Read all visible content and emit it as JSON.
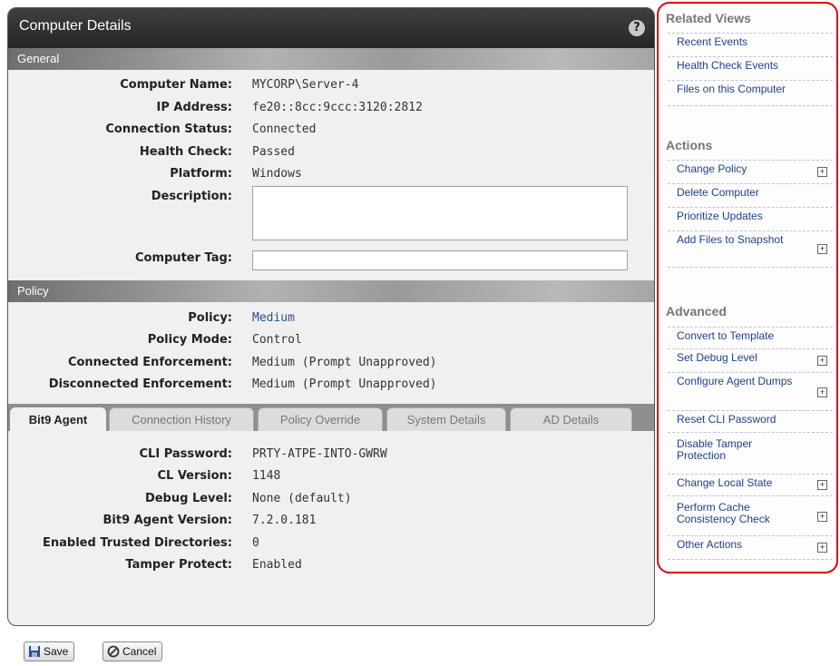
{
  "window": {
    "title": "Computer Details"
  },
  "general": {
    "section_label": "General",
    "fields": [
      {
        "label": "Computer Name:",
        "value": "MYCORP\\Server-4"
      },
      {
        "label": "IP Address:",
        "value": "fe20::8cc:9ccc:3120:2812"
      },
      {
        "label": "Connection Status:",
        "value": "Connected"
      },
      {
        "label": "Health Check:",
        "value": "Passed"
      },
      {
        "label": "Platform:",
        "value": "Windows"
      }
    ],
    "description_label": "Description:",
    "description_value": "",
    "tag_label": "Computer Tag:",
    "tag_value": ""
  },
  "policy": {
    "section_label": "Policy",
    "fields": [
      {
        "label": "Policy:",
        "value": "Medium"
      },
      {
        "label": "Policy Mode:",
        "value": "Control"
      },
      {
        "label": "Connected Enforcement:",
        "value": "Medium (Prompt Unapproved)"
      },
      {
        "label": "Disconnected Enforcement:",
        "value": "Medium (Prompt Unapproved)"
      }
    ]
  },
  "tabs": [
    {
      "label": "Bit9 Agent"
    },
    {
      "label": "Connection History"
    },
    {
      "label": "Policy Override"
    },
    {
      "label": "System Details"
    },
    {
      "label": "AD Details"
    }
  ],
  "agent": {
    "fields": [
      {
        "label": "CLI Password:",
        "value": "PRTY-ATPE-INTO-GWRW"
      },
      {
        "label": "CL Version:",
        "value": "1148"
      },
      {
        "label": "Debug Level:",
        "value": "None (default)"
      },
      {
        "label": "Bit9 Agent Version:",
        "value": "7.2.0.181"
      },
      {
        "label": "Enabled Trusted Directories:",
        "value": "0"
      },
      {
        "label": "Tamper Protect:",
        "value": "Enabled"
      }
    ]
  },
  "buttons": {
    "save": "Save",
    "cancel": "Cancel"
  },
  "sidebar": {
    "related_heading": "Related Views",
    "related": [
      "Recent Events",
      "Health Check Events",
      "Files on this Computer"
    ],
    "actions_heading": "Actions",
    "actions": [
      "Change Policy",
      "Delete Computer",
      "Prioritize Updates",
      "Add Files to Snapshot"
    ],
    "advanced_heading": "Advanced",
    "advanced": [
      "Convert to Template",
      "Set Debug Level",
      "Configure Agent Dumps",
      "Reset CLI Password",
      "Disable Tamper Protection",
      "Change Local State",
      "Perform Cache Consistency Check",
      "Other Actions"
    ],
    "plus_glyph": "+"
  },
  "colors": {
    "accent_border": "#e00000",
    "link": "#1f3f8c"
  }
}
